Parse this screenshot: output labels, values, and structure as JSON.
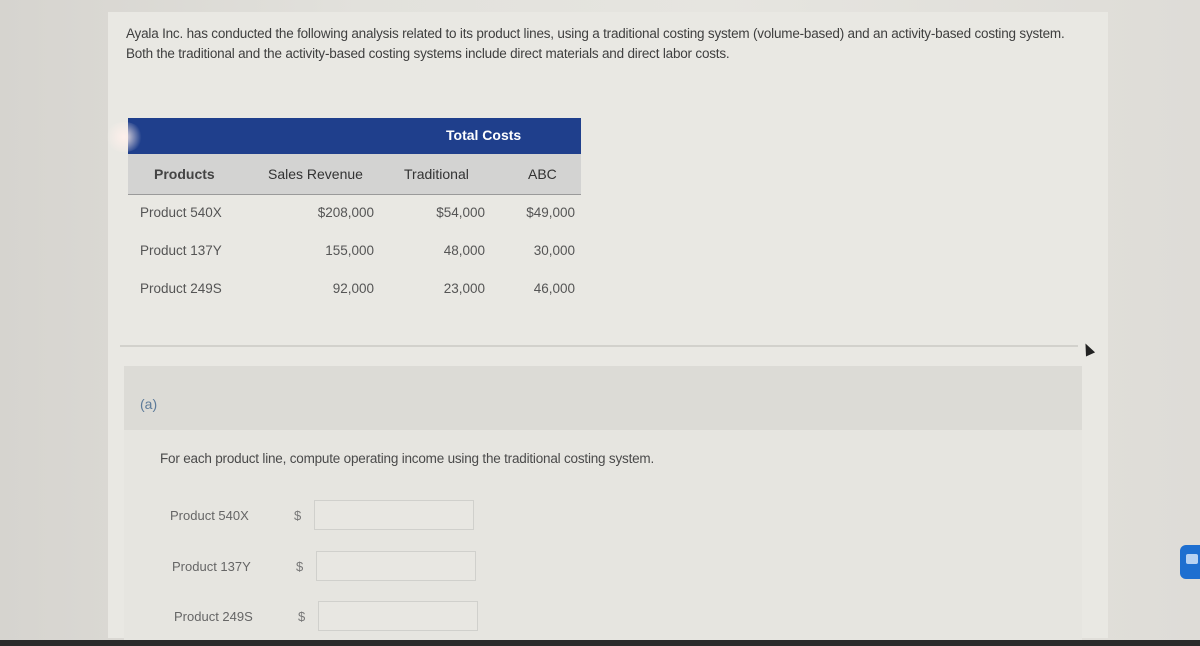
{
  "problem": {
    "intro": "Ayala Inc. has conducted the following analysis related to its product lines, using a traditional costing system (volume-based) and an activity-based costing system. Both the traditional and the activity-based costing systems include direct materials and direct labor costs."
  },
  "cost_table": {
    "group_header": "Total Costs",
    "columns": [
      "Products",
      "Sales Revenue",
      "Traditional",
      "ABC"
    ],
    "rows": [
      {
        "product": "Product 540X",
        "sales_revenue": "$208,000",
        "traditional": "$54,000",
        "abc": "$49,000"
      },
      {
        "product": "Product 137Y",
        "sales_revenue": "155,000",
        "traditional": "48,000",
        "abc": "30,000"
      },
      {
        "product": "Product 249S",
        "sales_revenue": "92,000",
        "traditional": "23,000",
        "abc": "46,000"
      }
    ]
  },
  "part_a": {
    "label": "(a)",
    "prompt": "For each product line, compute operating income using the traditional costing system.",
    "answers": [
      {
        "product": "Product 540X",
        "currency": "$",
        "value": ""
      },
      {
        "product": "Product 137Y",
        "currency": "$",
        "value": ""
      },
      {
        "product": "Product 249S",
        "currency": "$",
        "value": ""
      }
    ]
  },
  "colors": {
    "table_header_bg": "#1f3f8c",
    "subheader_bg": "#d3d3d2",
    "chat_button": "#1e6fd0"
  },
  "icons": {
    "chat": "chat-bubble-icon",
    "cursor": "mouse-pointer-icon"
  }
}
